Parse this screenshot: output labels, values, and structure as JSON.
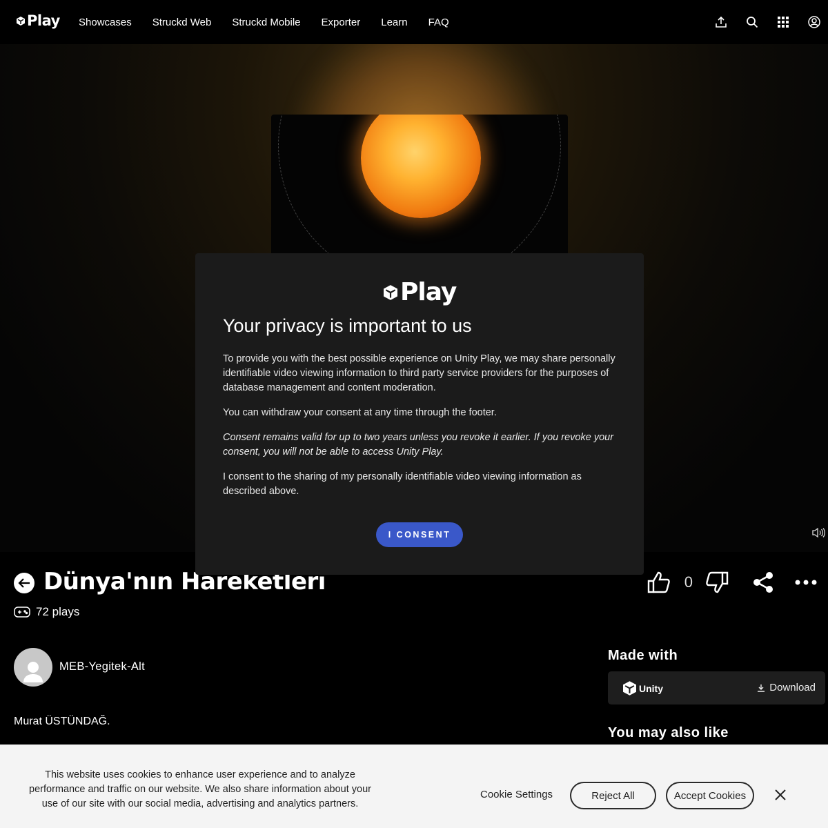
{
  "header": {
    "logo_text": "Play",
    "nav": [
      {
        "label": "Showcases"
      },
      {
        "label": "Struckd Web"
      },
      {
        "label": "Struckd Mobile"
      },
      {
        "label": "Exporter"
      },
      {
        "label": "Learn"
      },
      {
        "label": "FAQ"
      }
    ],
    "icons": [
      "upload-icon",
      "search-icon",
      "apps-grid-icon",
      "account-icon"
    ]
  },
  "modal": {
    "logo_text": "Play",
    "title": "Your privacy is important to us",
    "p1": "To provide you with the best possible experience on Unity Play, we may share personally identifiable video viewing information to third party service providers for the purposes of database management and content moderation.",
    "p2": "You can withdraw your consent at any time through the footer.",
    "p3": "Consent remains valid for up to two years unless you revoke it earlier. If you revoke your consent, you will not be able to access Unity Play.",
    "p4": "I consent to the sharing of my personally identifiable video viewing information as described above.",
    "button": "I CONSENT"
  },
  "game": {
    "title": "Dünya'nın Hareketleri",
    "plays": "72 plays",
    "likes": "0",
    "author": "MEB-Yegitek-Alt",
    "description": "Murat ÜSTÜNDAĞ."
  },
  "sidebar": {
    "made_with": "Made with",
    "engine": "Unity",
    "download": "Download",
    "also_like": "You may also like"
  },
  "cookie": {
    "text": "This website uses cookies to enhance user experience and to analyze performance and traffic on our website. We also share information about your use of our site with our social media, advertising and analytics partners.",
    "settings": "Cookie Settings",
    "reject": "Reject All",
    "accept": "Accept Cookies"
  },
  "colors": {
    "accent": "#3a58c9",
    "modal_bg": "#1b1b1b",
    "cookie_bg": "#f4f4f4"
  }
}
